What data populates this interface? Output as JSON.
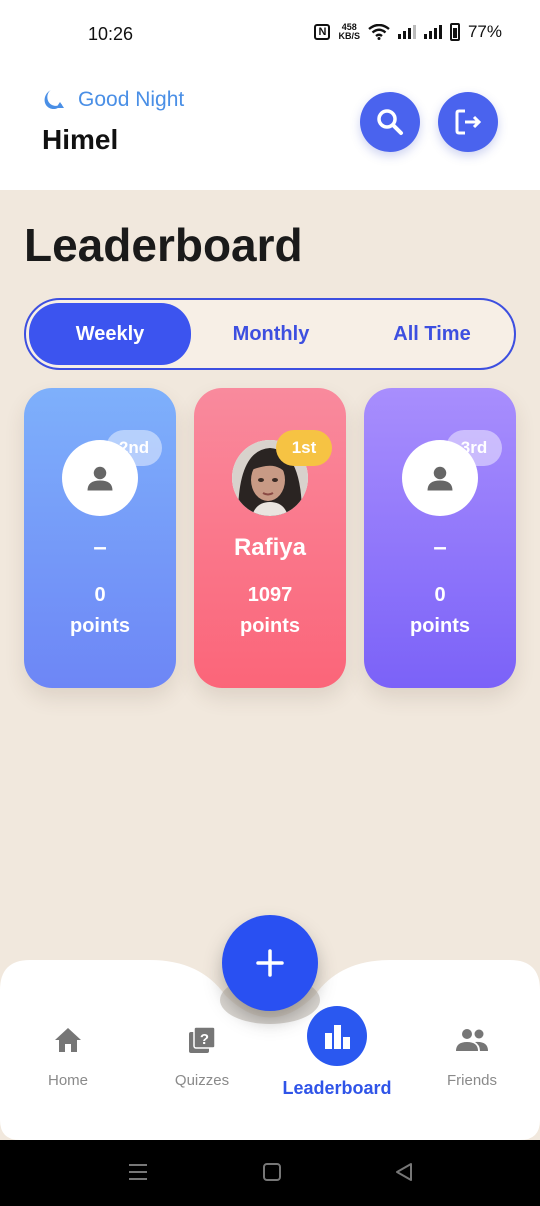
{
  "status": {
    "time": "10:26",
    "speed_top": "458",
    "speed_bottom": "KB/S",
    "battery": "77%"
  },
  "header": {
    "greeting": "Good Night",
    "user": "Himel"
  },
  "page": {
    "title": "Leaderboard"
  },
  "tabs": [
    {
      "label": "Weekly",
      "active": true
    },
    {
      "label": "Monthly",
      "active": false
    },
    {
      "label": "All Time",
      "active": false
    }
  ],
  "podium": {
    "second": {
      "rank": "2nd",
      "name": "–",
      "points": "0",
      "unit": "points"
    },
    "first": {
      "rank": "1st",
      "name": "Rafiya",
      "points": "1097",
      "unit": "points"
    },
    "third": {
      "rank": "3rd",
      "name": "–",
      "points": "0",
      "unit": "points"
    }
  },
  "nav": [
    {
      "label": "Home",
      "icon": "home-icon"
    },
    {
      "label": "Quizzes",
      "icon": "quiz-icon"
    },
    {
      "label": "Leaderboard",
      "icon": "leaderboard-icon",
      "active": true
    },
    {
      "label": "Friends",
      "icon": "friends-icon"
    }
  ],
  "colors": {
    "accent": "#3c54ef",
    "background": "#f1e8dd",
    "first": "#fb6579",
    "second": "#6d86f6",
    "third": "#7b62f8"
  }
}
